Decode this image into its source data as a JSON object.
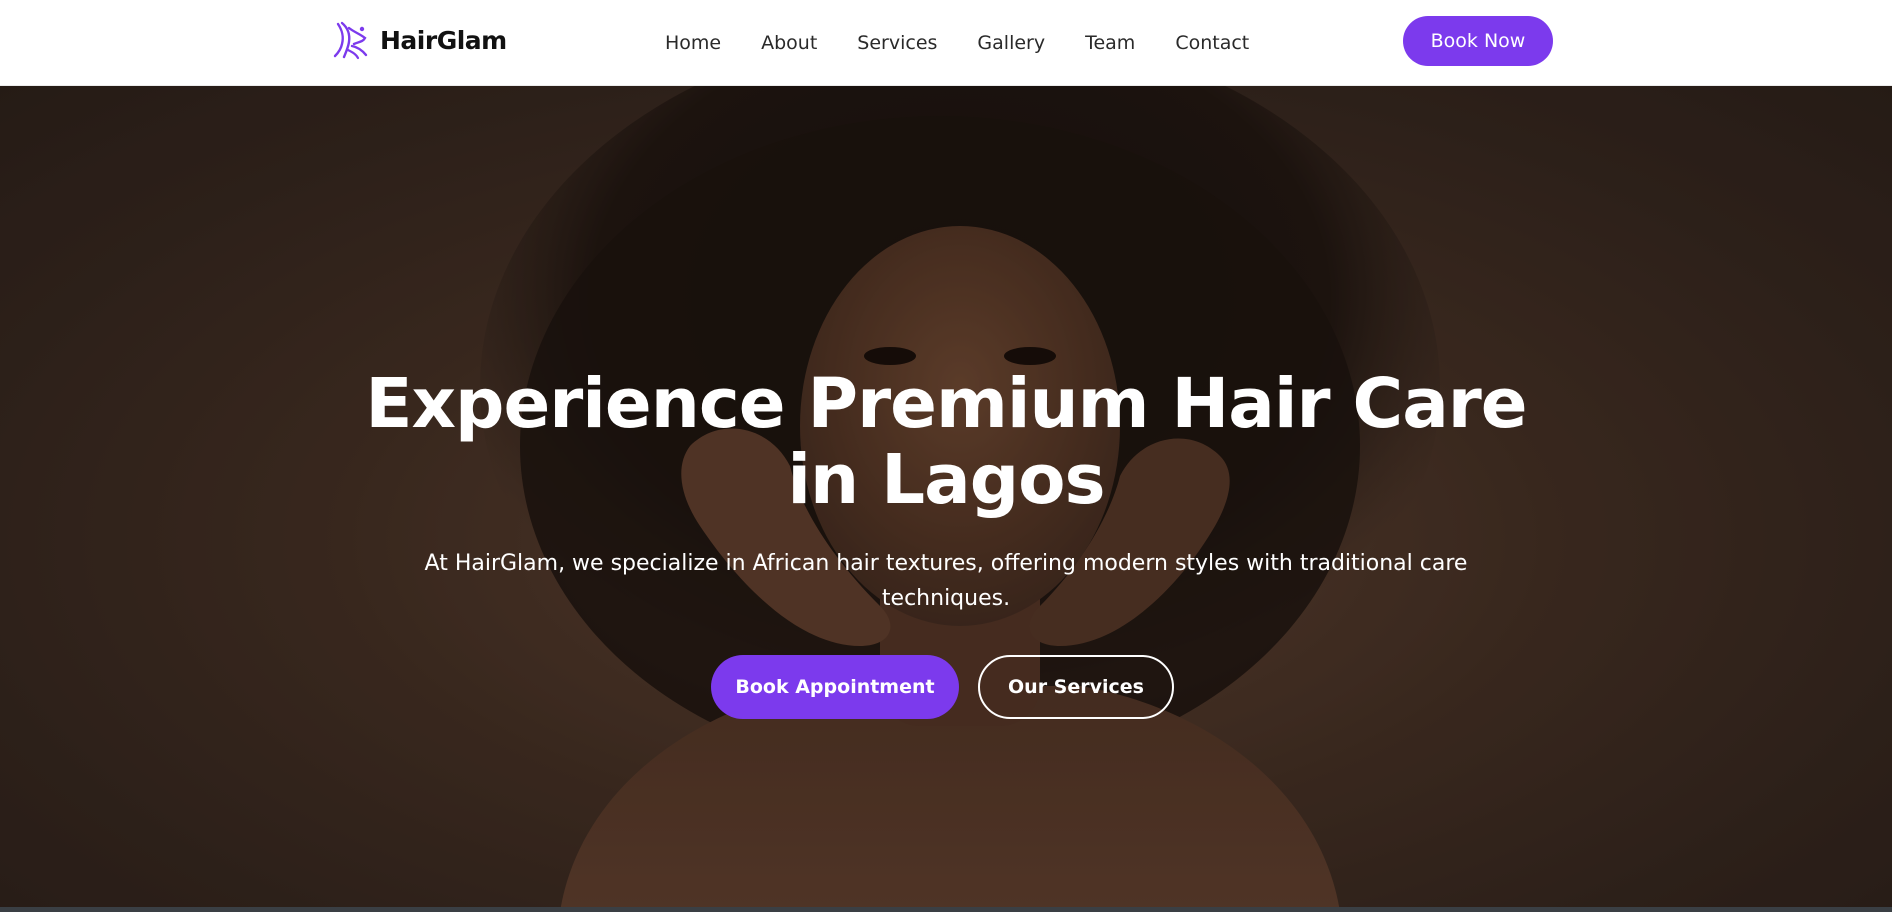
{
  "brand": {
    "name": "HairGlam",
    "icon": "hair-salon-logo-icon",
    "accent_color": "#7c3aed"
  },
  "nav": {
    "links": [
      "Home",
      "About",
      "Services",
      "Gallery",
      "Team",
      "Contact"
    ],
    "cta_label": "Book Now"
  },
  "hero": {
    "title_line1": "Experience Premium Hair Care",
    "title_line2": "in Lagos",
    "subtitle_line1": "At HairGlam, we specialize in African hair textures, offering modern styles with traditional care",
    "subtitle_line2": "techniques.",
    "primary_button": "Book Appointment",
    "secondary_button": "Our Services",
    "background": "portrait-photo"
  }
}
